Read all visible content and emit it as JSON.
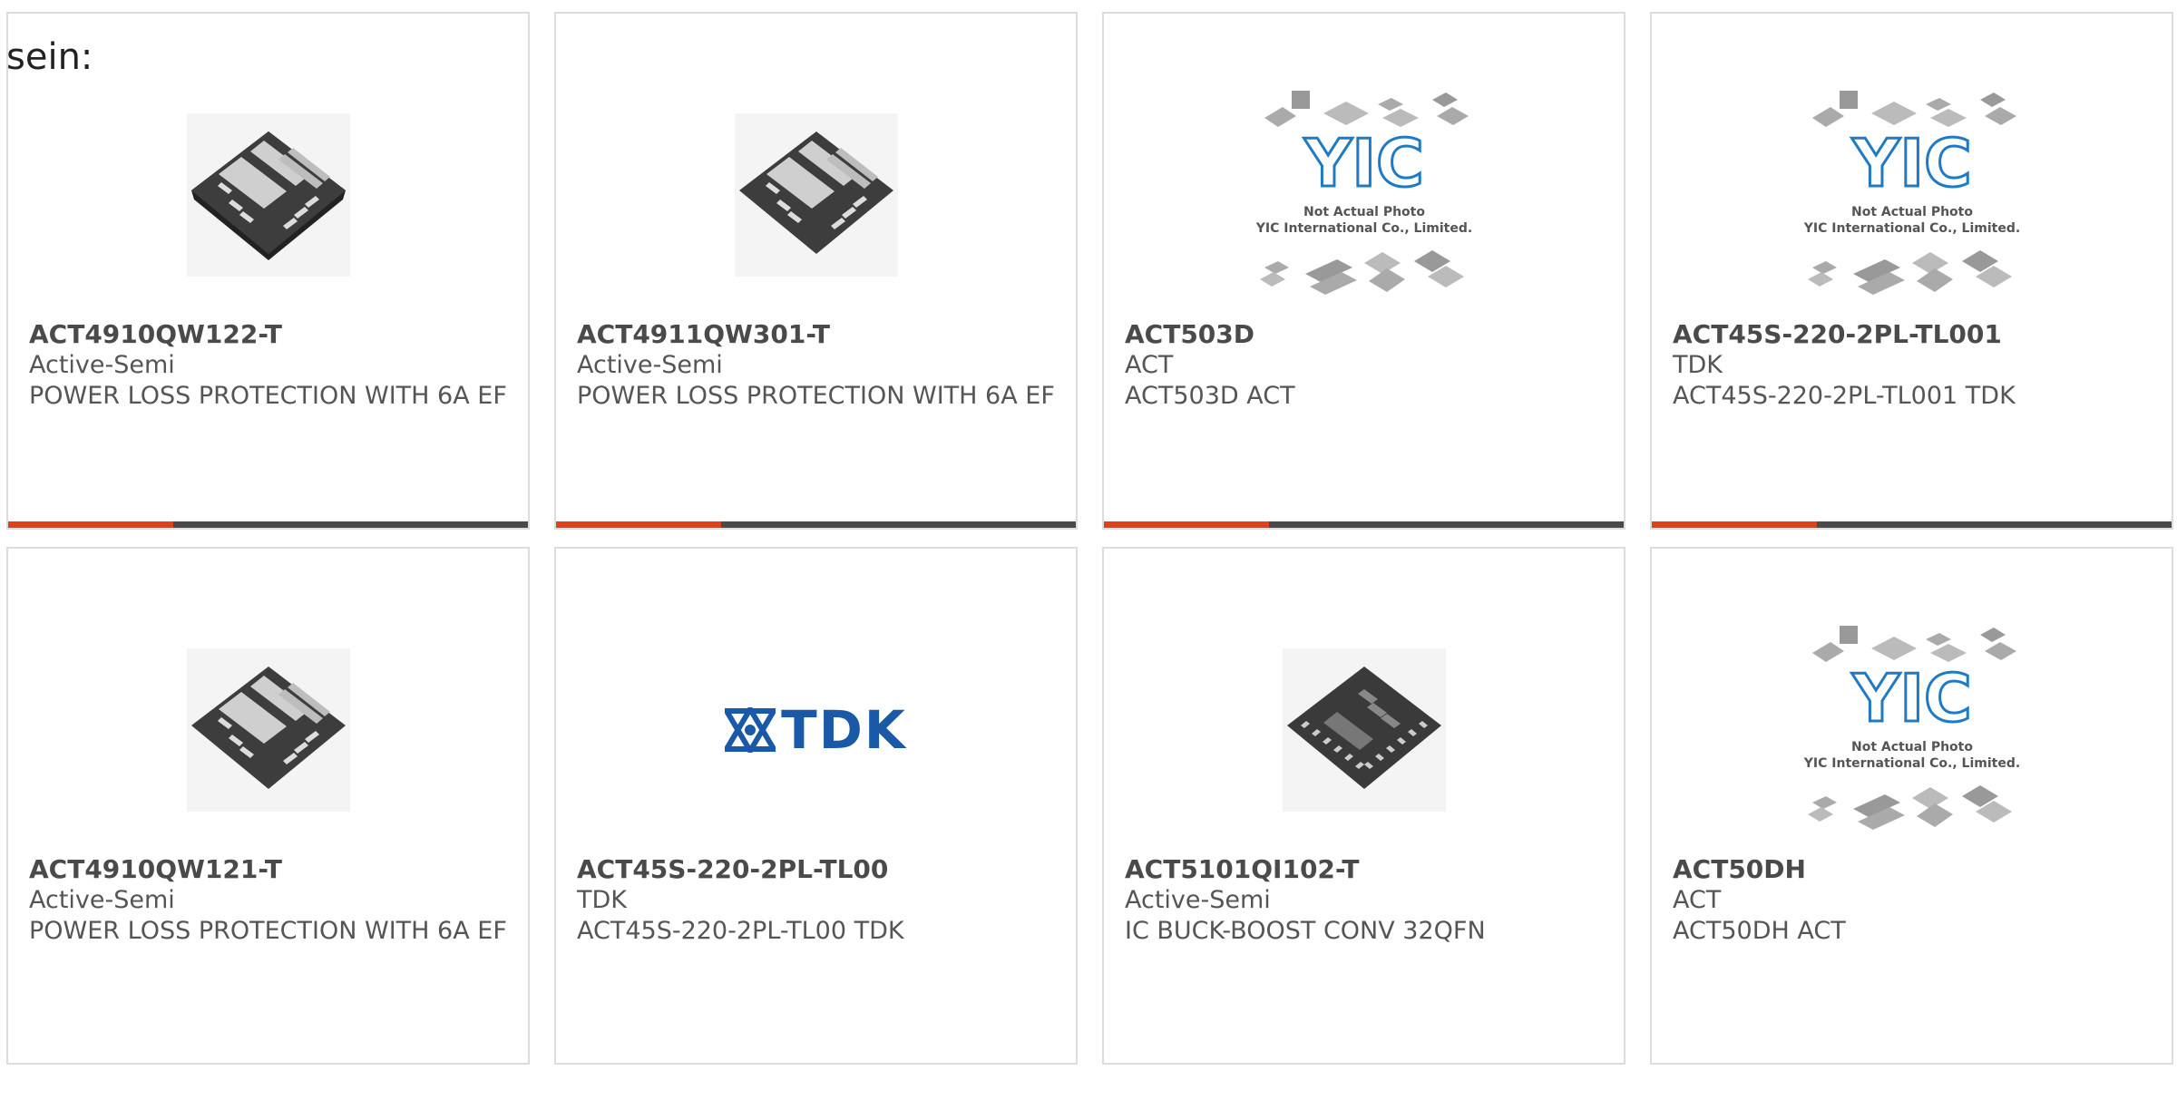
{
  "page_label": "sein:",
  "colors": {
    "accent": "#e0401a",
    "bar": "#4a4a4a",
    "tdk_blue": "#1a58a8",
    "yic_blue": "#1f7ac6"
  },
  "products": [
    {
      "part_number": "ACT4910QW122-T",
      "manufacturer": "Active-Semi",
      "description": "POWER LOSS PROTECTION WITH 6A EF",
      "image": "qfn-power-chip"
    },
    {
      "part_number": "ACT4911QW301-T",
      "manufacturer": "Active-Semi",
      "description": "POWER LOSS PROTECTION WITH 6A EF",
      "image": "qfn-power-chip"
    },
    {
      "part_number": "ACT503D",
      "manufacturer": "ACT",
      "description": "ACT503D ACT",
      "image": "yic-not-actual-photo",
      "image_text": {
        "logo": "YIC",
        "line1": "Not Actual Photo",
        "line2": "YIC International Co., Limited."
      }
    },
    {
      "part_number": "ACT45S-220-2PL-TL001",
      "manufacturer": "TDK",
      "description": "ACT45S-220-2PL-TL001 TDK",
      "image": "yic-not-actual-photo",
      "image_text": {
        "logo": "YIC",
        "line1": "Not Actual Photo",
        "line2": "YIC International Co., Limited."
      }
    },
    {
      "part_number": "ACT4910QW121-T",
      "manufacturer": "Active-Semi",
      "description": "POWER LOSS PROTECTION WITH 6A EF",
      "image": "qfn-power-chip"
    },
    {
      "part_number": "ACT45S-220-2PL-TL00",
      "manufacturer": "TDK",
      "description": "ACT45S-220-2PL-TL00 TDK",
      "image": "tdk-logo",
      "image_text": {
        "logo": "TDK"
      }
    },
    {
      "part_number": "ACT5101QI102-T",
      "manufacturer": "Active-Semi",
      "description": "IC BUCK-BOOST CONV 32QFN",
      "image": "qfn-32-chip"
    },
    {
      "part_number": "ACT50DH",
      "manufacturer": "ACT",
      "description": "ACT50DH ACT",
      "image": "yic-not-actual-photo",
      "image_text": {
        "logo": "YIC",
        "line1": "Not Actual Photo",
        "line2": "YIC International Co., Limited."
      }
    }
  ]
}
